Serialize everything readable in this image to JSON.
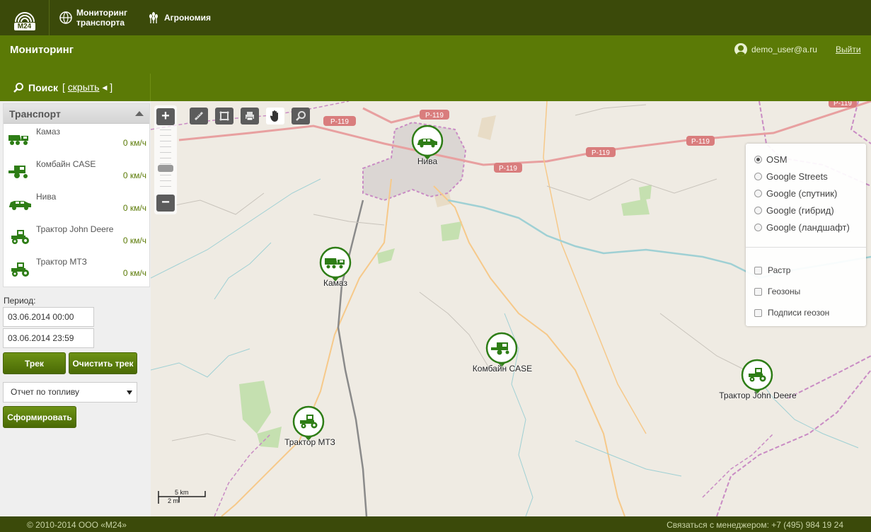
{
  "nav": {
    "logo": "M24",
    "items": [
      {
        "label_line1": "Мониторинг",
        "label_line2": "транспорта",
        "icon": "globe-icon"
      },
      {
        "label": "Агрономия",
        "icon": "wheat-icon"
      }
    ]
  },
  "header": {
    "title": "Мониторинг",
    "user": "demo_user@a.ru",
    "logout": "Выйти"
  },
  "search": {
    "label": "Поиск",
    "toggle_open": "[",
    "toggle_link": "скрыть",
    "toggle_close": "]"
  },
  "transport": {
    "title": "Транспорт",
    "vehicles": [
      {
        "name": "Камаз",
        "speed": "0 км/ч",
        "icon": "dump-truck-icon"
      },
      {
        "name": "Комбайн CASE",
        "speed": "0 км/ч",
        "icon": "combine-icon"
      },
      {
        "name": "Нива",
        "speed": "0 км/ч",
        "icon": "car-icon"
      },
      {
        "name": "Трактор John Deere",
        "speed": "0 км/ч",
        "icon": "tractor-icon"
      },
      {
        "name": "Трактор МТЗ",
        "speed": "0 км/ч",
        "icon": "tractor-icon"
      }
    ]
  },
  "period": {
    "label": "Период:",
    "from": "03.06.2014 00:00",
    "to": "03.06.2014 23:59"
  },
  "buttons": {
    "track": "Трек",
    "clear_track": "Очистить трек",
    "generate": "Сформировать"
  },
  "report": {
    "selected": "Отчет по топливу"
  },
  "map": {
    "layers": {
      "base": [
        "OSM",
        "Google Streets",
        "Google (спутник)",
        "Google (гибрид)",
        "Google (ландшафт)"
      ],
      "selected_base": "OSM",
      "overlays": [
        "Растр",
        "Геозоны",
        "Подписи геозон"
      ]
    },
    "markers": [
      {
        "label": "Нива"
      },
      {
        "label": "Камаз"
      },
      {
        "label": "Комбайн CASE"
      },
      {
        "label": "Трактор John Deere"
      },
      {
        "label": "Трактор МТЗ"
      }
    ],
    "road_labels": [
      "Р-119",
      "Р-119",
      "Р-119",
      "Р-119",
      "Р-119",
      "Р-119"
    ],
    "scale": {
      "km": "5 km",
      "mi": "2 mi"
    }
  },
  "footer": {
    "copyright": "© 2010-2014 ООО «М24»",
    "contact": "Связаться с менеджером: +7 (495) 984 19 24"
  },
  "colors": {
    "nav_bg": "#3b4a0a",
    "header_bg": "#5b7a06",
    "accent_green": "#2e7d16",
    "map_bg": "#efebe3"
  }
}
